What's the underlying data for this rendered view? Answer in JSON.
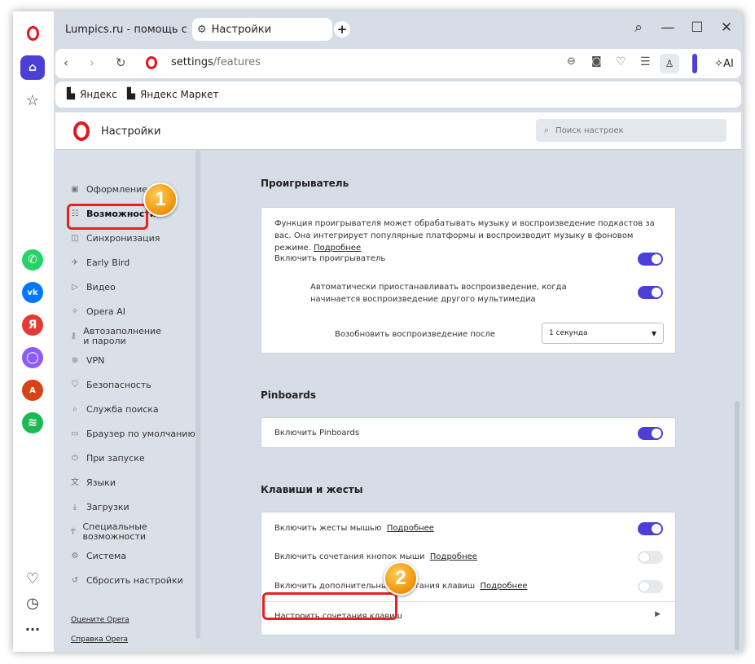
{
  "tabs": [
    {
      "title": "Lumpics.ru - помощь с ко"
    },
    {
      "title": "Настройки"
    }
  ],
  "address": {
    "host": "settings",
    "path": "/features"
  },
  "ai_label": "AI",
  "bookmarks": [
    {
      "label": "Яндекс"
    },
    {
      "label": "Яндекс Маркет"
    }
  ],
  "header": {
    "title": "Настройки",
    "search_placeholder": "Поиск настроек"
  },
  "nav": {
    "items": [
      {
        "label": "Оформление",
        "icon": "image-icon"
      },
      {
        "label": "Возможности",
        "icon": "list-icon"
      },
      {
        "label": "Синхронизация",
        "icon": "sync-icon"
      },
      {
        "label": "Early Bird",
        "icon": "bird-icon"
      },
      {
        "label": "Видео",
        "icon": "play-icon"
      },
      {
        "label": "Opera AI",
        "icon": "ai-icon"
      },
      {
        "label": "Автозаполнение и пароли",
        "icon": "key-icon"
      },
      {
        "label": "VPN",
        "icon": "vpn-icon"
      },
      {
        "label": "Безопасность",
        "icon": "shield-icon"
      },
      {
        "label": "Служба поиска",
        "icon": "search-icon"
      },
      {
        "label": "Браузер по умолчанию",
        "icon": "browser-icon"
      },
      {
        "label": "При запуске",
        "icon": "power-icon"
      },
      {
        "label": "Языки",
        "icon": "language-icon"
      },
      {
        "label": "Загрузки",
        "icon": "download-icon"
      },
      {
        "label": "Специальные возможности",
        "icon": "accessibility-icon"
      },
      {
        "label": "Система",
        "icon": "gear-icon"
      },
      {
        "label": "Сбросить настройки",
        "icon": "reset-icon"
      }
    ],
    "rate": "Оцените Opera",
    "help": "Справка Opera"
  },
  "player": {
    "title": "Проигрыватель",
    "desc": "Функция проигрывателя может обрабатывать музыку и воспроизведение подкастов за вас. Она интегрирует популярные платформы и воспроизводит музыку в фоновом режиме.",
    "more": "Подробнее",
    "enable": "Включить проигрыватель",
    "auto_pause": "Автоматически приостанавливать воспроизведение, когда начинается воспроизведение другого мультимедиа",
    "resume_label": "Возобновить воспроизведение после",
    "resume_value": "1 секунда"
  },
  "pinboards": {
    "title": "Pinboards",
    "enable": "Включить Pinboards"
  },
  "keys": {
    "title": "Клавиши и жесты",
    "gestures": "Включить жесты мышью",
    "gestures_more": "Подробнее",
    "rocker": "Включить сочетания кнопок мыши",
    "rocker_more": "Подробнее",
    "extra": "Включить дополнительные сочетания клавиш",
    "extra_more": "Подробнее",
    "configure": "Настроить сочетания клавиш"
  },
  "badges": {
    "one": "1",
    "two": "2"
  },
  "colors": {
    "accent": "#4b3fd6",
    "opera_red": "#e4141c",
    "highlight": "#e82020"
  }
}
